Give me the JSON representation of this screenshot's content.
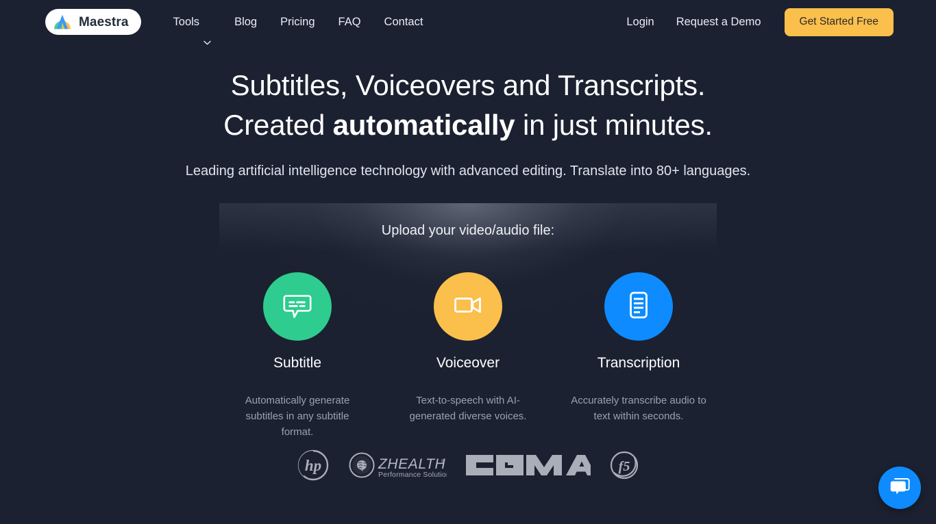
{
  "brand": {
    "name": "Maestra",
    "logo_icon": "maestra-m-logo",
    "logo_colors": {
      "green": "#4ec9a0",
      "blue": "#3b9bf0",
      "yellow": "#fbbf4c"
    }
  },
  "colors": {
    "background": "#1b2130",
    "accent_yellow": "#fbbf4c",
    "accent_green": "#2ecc8f",
    "accent_blue": "#0d8bff",
    "text_primary": "#ffffff",
    "text_muted": "#99a1b3"
  },
  "header": {
    "nav_items": [
      {
        "label": "Tools",
        "has_dropdown": true,
        "icon": "chevron-down-icon"
      },
      {
        "label": "Blog",
        "has_dropdown": false
      },
      {
        "label": "Pricing",
        "has_dropdown": false
      },
      {
        "label": "FAQ",
        "has_dropdown": false
      },
      {
        "label": "Contact",
        "has_dropdown": false
      }
    ],
    "login_label": "Login",
    "demo_label": "Request a Demo",
    "cta_label": "Get Started Free"
  },
  "hero": {
    "headline_line1": "Subtitles, Voiceovers and Transcripts.",
    "headline_line2_pre": "Created ",
    "headline_line2_bold": "automatically",
    "headline_line2_post": " in just minutes.",
    "subheadline": "Leading artificial intelligence technology with advanced editing. Translate into 80+ languages."
  },
  "upload": {
    "title": "Upload your video/audio file:",
    "options": [
      {
        "label": "Subtitle",
        "description": "Automatically generate subtitles in any subtitle format.",
        "icon": "subtitle-bubble-icon",
        "color": "#2ecc8f"
      },
      {
        "label": "Voiceover",
        "description": "Text-to-speech with AI-generated diverse voices.",
        "icon": "video-camera-icon",
        "color": "#fbbf4c"
      },
      {
        "label": "Transcription",
        "description": "Accurately transcribe audio to text within seconds.",
        "icon": "document-lines-icon",
        "color": "#0d8bff"
      }
    ]
  },
  "clients": [
    {
      "name": "HP",
      "icon": "hp-logo"
    },
    {
      "name": "ZHEALTH",
      "tagline": "Performance Solutions",
      "icon": "zhealth-logo"
    },
    {
      "name": "CGMA",
      "icon": "cgma-logo"
    },
    {
      "name": "f5",
      "icon": "f5-logo"
    }
  ],
  "chat": {
    "icon": "chat-bubbles-icon",
    "aria_label": "Open chat"
  }
}
